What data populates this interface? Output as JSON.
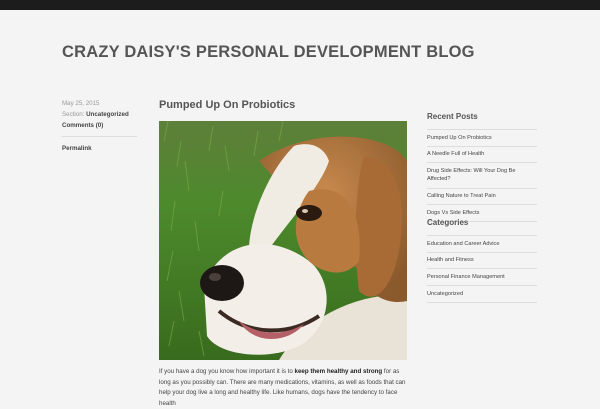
{
  "site": {
    "title": "CRAZY DAISY'S PERSONAL DEVELOPMENT BLOG"
  },
  "post": {
    "title": "Pumped Up On Probiotics",
    "meta": {
      "date": "May 25, 2015",
      "section_label": "Section:",
      "section_value": "Uncategorized",
      "comments": "Comments (0)",
      "permalink": "Permalink"
    },
    "image_alt": "Beagle dog portrait on grass",
    "body": {
      "part1": "If you have a dog you know how important it is to ",
      "bold": "keep them healthy and strong",
      "part2": " for as long as you possibly can. There are many medications, vitamins, as well as foods that can help your dog live a long and healthy life. Like humans, dogs have the tendency to face health"
    }
  },
  "sidebar": {
    "recent": {
      "title": "Recent Posts",
      "items": [
        "Pumped Up On Probiotics",
        "A Needle Full of Health",
        "Drug Side Effects: Will Your Dog Be Affected?",
        "Calling Nature to Treat Pain",
        "Dogs Vs Side Effects"
      ]
    },
    "categories": {
      "title": "Categories",
      "items": [
        "Education and Career Advice",
        "Health and Fitness",
        "Personal Finance Management",
        "Uncategorized"
      ]
    }
  },
  "colors": {
    "topbar": "#1c1c1c",
    "background": "#f4f4f4",
    "text": "#444444"
  }
}
